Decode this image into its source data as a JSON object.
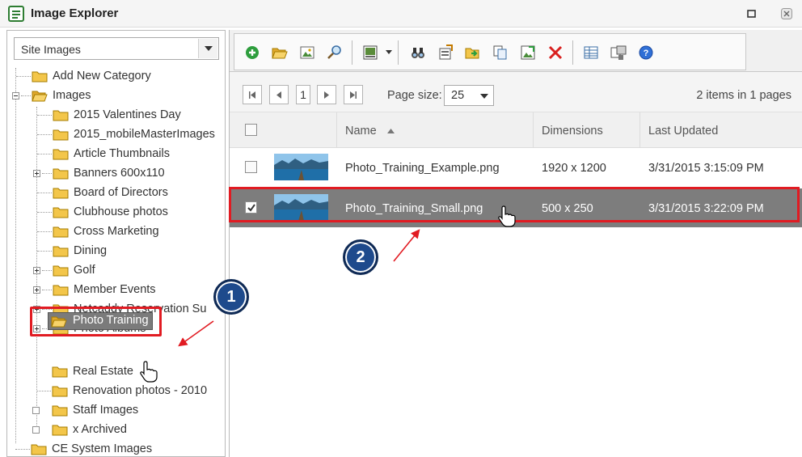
{
  "window": {
    "title": "Image Explorer"
  },
  "left": {
    "category_select": "Site Images",
    "tree": [
      {
        "label": "Add New Category"
      },
      {
        "label": "Images"
      },
      {
        "label": "2015 Valentines Day"
      },
      {
        "label": "2015_mobileMasterImages"
      },
      {
        "label": "Article Thumbnails"
      },
      {
        "label": "Banners 600x110"
      },
      {
        "label": "Board of Directors"
      },
      {
        "label": "Clubhouse photos"
      },
      {
        "label": "Cross Marketing"
      },
      {
        "label": "Dining"
      },
      {
        "label": "Golf"
      },
      {
        "label": "Member Events"
      },
      {
        "label": "Netcaddy Reservation Su"
      },
      {
        "label": "Photo Albums"
      },
      {
        "label": "Photo Training"
      },
      {
        "label": "Real Estate"
      },
      {
        "label": "Renovation photos - 2010"
      },
      {
        "label": "Staff Images"
      },
      {
        "label": "x Archived"
      },
      {
        "label": "CE System Images"
      }
    ]
  },
  "pager": {
    "current_page": "1",
    "page_size_label": "Page size:",
    "page_size": "25",
    "info": "2 items in 1 pages"
  },
  "grid": {
    "columns": {
      "name": "Name",
      "dimensions": "Dimensions",
      "last_updated": "Last Updated"
    },
    "rows": [
      {
        "name": "Photo_Training_Example.png",
        "dimensions": "1920 x 1200",
        "last_updated": "3/31/2015 3:15:09 PM",
        "checked": false
      },
      {
        "name": "Photo_Training_Small.png",
        "dimensions": "500 x 250",
        "last_updated": "3/31/2015 3:22:09 PM",
        "checked": true
      }
    ]
  },
  "callouts": {
    "step1": "1",
    "step2": "2"
  },
  "colors": {
    "highlight": "#e11b22",
    "badge": "#1e4a8c",
    "selected_row": "#7d7d7d"
  }
}
